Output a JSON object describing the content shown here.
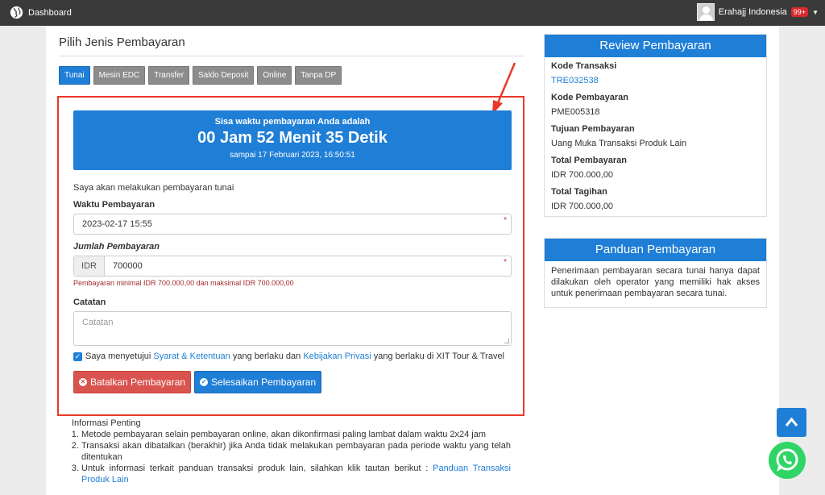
{
  "topbar": {
    "brand": "Dashboard",
    "user": "Erahajj Indonesia",
    "badge": "99+"
  },
  "left": {
    "title": "Pilih Jenis Pembayaran",
    "tabs": [
      "Tunai",
      "Mesin EDC",
      "Transfer",
      "Saldo Deposit",
      "Online",
      "Tanpa DP"
    ],
    "active_tab": "Tunai"
  },
  "timer": {
    "line1": "Sisa waktu pembayaran Anda adalah",
    "line2": "00 Jam 52 Menit 35 Detik",
    "line3": "sampai 17 Februari 2023, 16:50:51"
  },
  "form": {
    "intro": "Saya akan melakukan pembayaran tunai",
    "waktu_label": "Waktu Pembayaran",
    "waktu_value": "2023-02-17 15:55",
    "required_mark": "*",
    "jumlah_label": "Jumlah Pembayaran",
    "currency": "IDR",
    "jumlah_value": "700000",
    "jumlah_help": "Pembayaran minimal IDR 700.000,00 dan maksimal IDR 700.000,00",
    "catatan_label": "Catatan",
    "catatan_placeholder": "Catatan",
    "agree_pre": "Saya menyetujui",
    "agree_link1": "Syarat & Ketentuan",
    "agree_mid": "yang berlaku dan",
    "agree_link2": "Kebijakan Privasi",
    "agree_post": "yang berlaku di XIT Tour & Travel",
    "cancel_button": "Batalkan Pembayaran",
    "finish_button": "Selesaikan Pembayaran"
  },
  "info": {
    "title": "Informasi Penting",
    "item1": "Metode pembayaran selain pembayaran online, akan dikonfirmasi paling lambat dalam waktu 2x24 jam",
    "item2": "Transaksi akan dibatalkan (berakhir) jika Anda tidak melakukan pembayaran pada periode waktu yang telah ditentukan",
    "item3_pre": "Untuk informasi terkait panduan transaksi produk lain, silahkan klik tautan berikut :",
    "item3_link": "Panduan Transaksi Produk Lain"
  },
  "review": {
    "title": "Review Pembayaran",
    "kode_transaksi_label": "Kode Transaksi",
    "kode_transaksi_value": "TRE032538",
    "kode_pembayaran_label": "Kode Pembayaran",
    "kode_pembayaran_value": "PME005318",
    "tujuan_label": "Tujuan Pembayaran",
    "tujuan_value": "Uang Muka Transaksi Produk Lain",
    "total_pembayaran_label": "Total Pembayaran",
    "total_pembayaran_value": "IDR 700.000,00",
    "total_tagihan_label": "Total Tagihan",
    "total_tagihan_value": "IDR 700.000,00"
  },
  "panduan": {
    "title": "Panduan Pembayaran",
    "text": "Penerimaan pembayaran secara tunai hanya dapat dilakukan oleh operator yang memiliki hak akses untuk penerimaan pembayaran secara tunai."
  },
  "colors": {
    "primary": "#1f7ed6",
    "danger": "#d9534f",
    "highlight": "#e8382a",
    "topbar": "#3a3a3a"
  }
}
